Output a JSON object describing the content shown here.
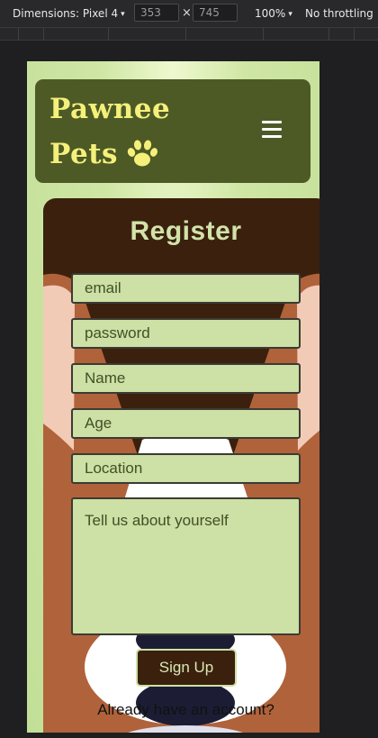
{
  "devtools": {
    "device_label": "Dimensions: Pixel 4",
    "width": "353",
    "times": "×",
    "height": "745",
    "zoom": "100%",
    "throttling": "No throttling",
    "caret": "▾"
  },
  "site": {
    "brand_line1": "Pawnee",
    "brand_line2": "Pets",
    "menu_icon": "hamburger-icon",
    "paw_icon": "paw-icon"
  },
  "register": {
    "title": "Register",
    "fields": {
      "email": "email",
      "password": "password",
      "name": "Name",
      "age": "Age",
      "location": "Location",
      "about": "Tell us about yourself"
    },
    "signup_label": "Sign Up",
    "already_text": "Already have an account?"
  },
  "colors": {
    "header_bg": "#4d5a26",
    "brand_text": "#f5f07a",
    "card_bg": "#3b200d",
    "field_bg": "#cde0a5",
    "page_bg": "#c2df98"
  }
}
